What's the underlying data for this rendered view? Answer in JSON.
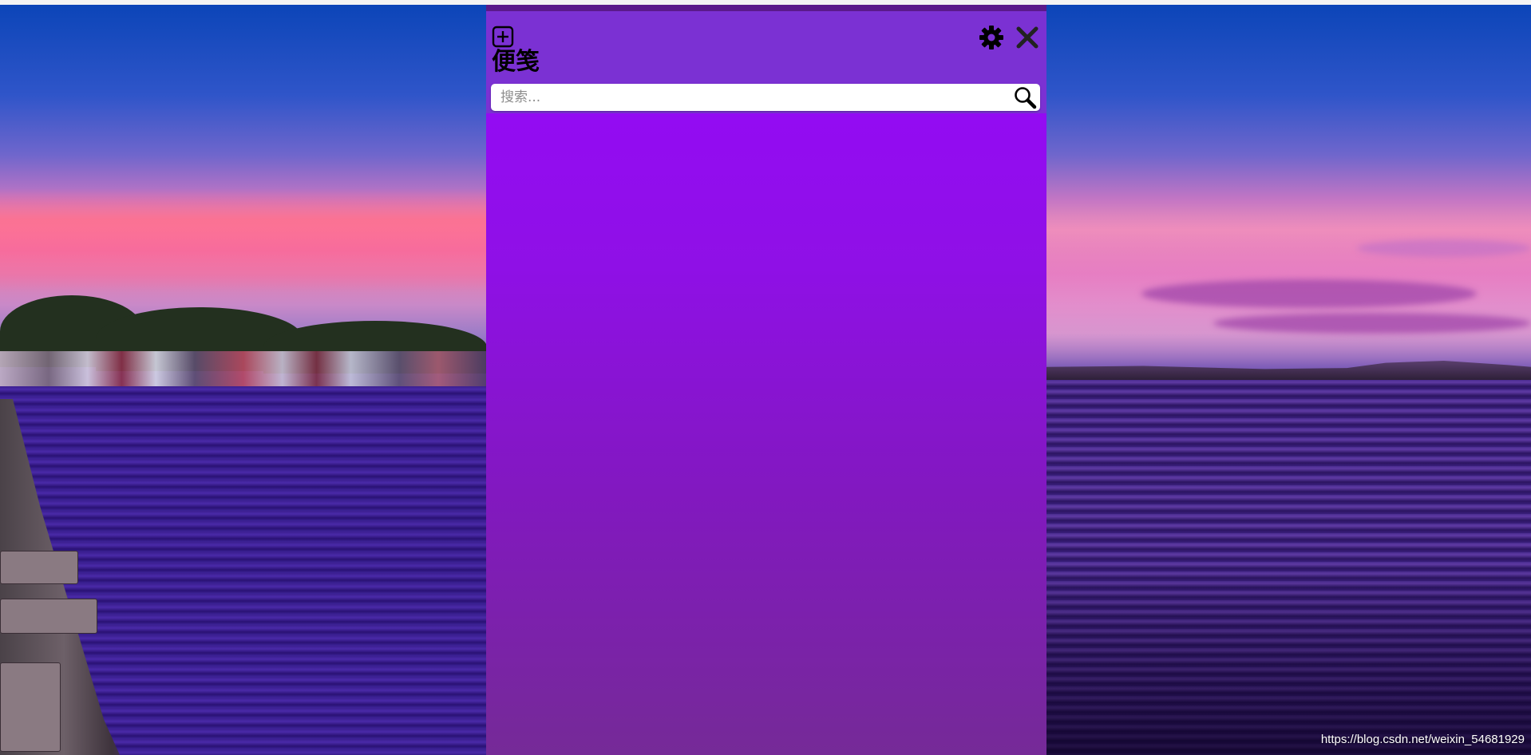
{
  "app": {
    "title": "便笺",
    "accent_color": "#7b31d3",
    "panel_gradient": [
      "#9608fb",
      "#752a97"
    ]
  },
  "header": {
    "add_icon": "plus-square-icon",
    "settings_icon": "gear-icon",
    "close_icon": "close-icon"
  },
  "search": {
    "placeholder": "搜索...",
    "value": "",
    "icon": "magnifier-icon"
  },
  "watermark": {
    "text": "https://blog.csdn.net/weixin_54681929"
  }
}
